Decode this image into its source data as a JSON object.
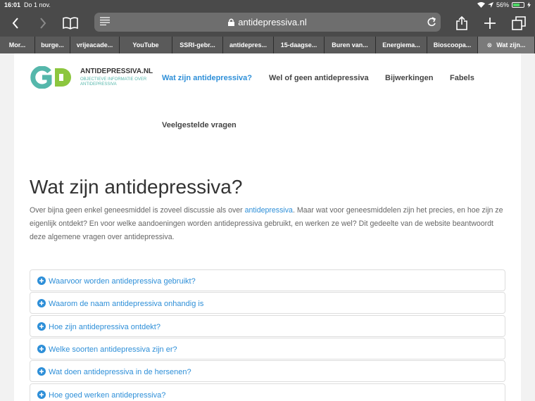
{
  "status": {
    "time": "16:01",
    "date": "Do 1 nov.",
    "battery": "56%"
  },
  "browser": {
    "url": "antidepressiva.nl",
    "tabs": [
      {
        "label": "Mor...",
        "w": 50
      },
      {
        "label": "burge...",
        "w": 50
      },
      {
        "label": "vrijeacade...",
        "w": 70
      },
      {
        "label": "YouTube",
        "w": 75
      },
      {
        "label": "SSRI-gebr...",
        "w": 72
      },
      {
        "label": "antidepres...",
        "w": 72
      },
      {
        "label": "15-daagse...",
        "w": 72
      },
      {
        "label": "Buren van...",
        "w": 73
      },
      {
        "label": "Energiema...",
        "w": 73
      },
      {
        "label": "Bioscoopa...",
        "w": 72
      },
      {
        "label": "Wat zijn...",
        "w": 81,
        "active": true
      }
    ]
  },
  "site": {
    "logo_name": "ANTIDEPRESSIVA.NL",
    "logo_tagline": "OBJECTIEVE INFORMATIE OVER ANTIDEPRESSIVA",
    "nav": {
      "wat_zijn": "Wat zijn antidepressiva?",
      "wel_geen": "Wel of geen antidepressiva",
      "bijwerkingen": "Bijwerkingen",
      "fabels": "Fabels",
      "faq": "Veelgestelde vragen"
    },
    "title": "Wat zijn antidepressiva?",
    "intro_before": "Over bijna geen enkel geneesmiddel is zoveel discussie als over ",
    "intro_link": "antidepressiva",
    "intro_after": ". Maar wat voor geneesmiddelen zijn het precies, en hoe zijn ze eigenlijk ontdekt? En voor welke aandoeningen worden antidepressiva gebruikt, en werken ze wel? Dit gedeelte van de website beantwoordt deze algemene vragen over antidepressiva.",
    "faqs": [
      "Waarvoor worden antidepressiva gebruikt?",
      "Waarom de naam antidepressiva onhandig is",
      "Hoe zijn antidepressiva ontdekt?",
      "Welke soorten antidepressiva zijn er?",
      "Wat doen antidepressiva in de hersenen?",
      "Hoe goed werken antidepressiva?"
    ]
  },
  "colors": {
    "link": "#2e8fd8",
    "accent": "#55b7ab",
    "chrome": "#4a4a4a"
  }
}
